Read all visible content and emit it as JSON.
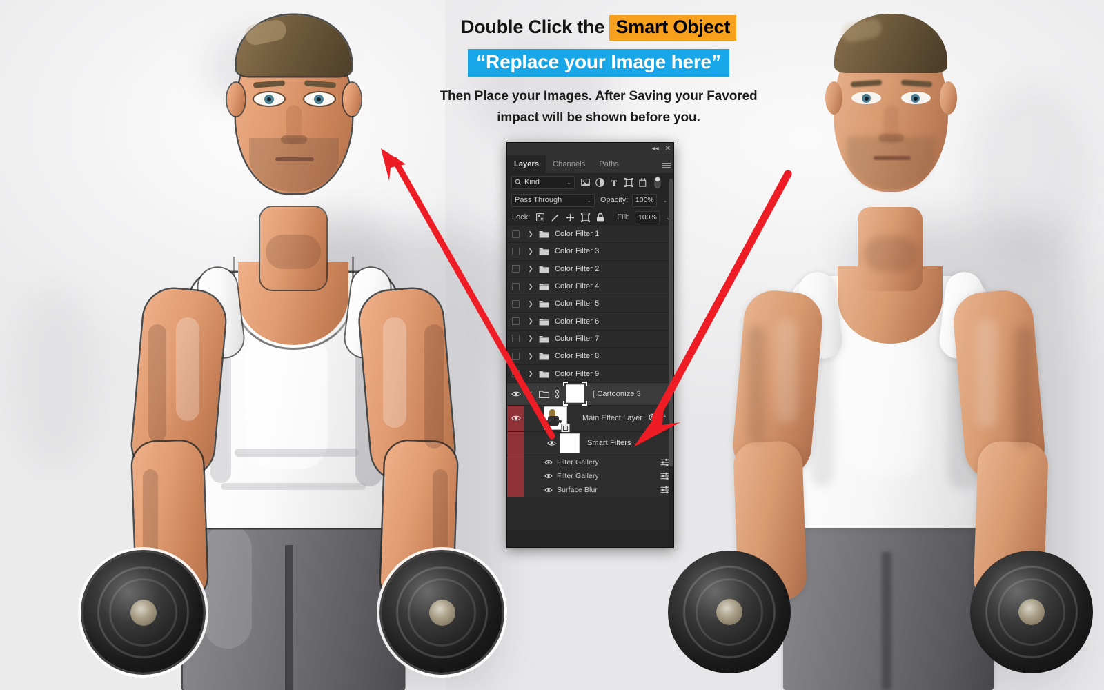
{
  "instructions": {
    "line1_prefix": "Double Click the ",
    "line1_highlight": "Smart Object",
    "line2_highlight": "“Replace your Image here”",
    "line3_a": "Then Place your Images. After Saving your Favored",
    "line3_b": "impact will be shown before you.",
    "highlight_orange": "#F6A01E",
    "highlight_blue": "#17A7E8"
  },
  "panel": {
    "titlebar": {
      "collapse_icon": "◂◂",
      "close_icon": "✕"
    },
    "tabs": [
      {
        "label": "Layers",
        "active": true
      },
      {
        "label": "Channels",
        "active": false
      },
      {
        "label": "Paths",
        "active": false
      }
    ],
    "menu_icon": "hamburger-icon",
    "filter": {
      "search_icon": "search-icon",
      "kind_label": "Kind",
      "chevron": "⌄",
      "icons": [
        "pixel-layer-icon",
        "adjustment-layer-icon",
        "type-layer-icon",
        "shape-layer-icon",
        "smart-object-icon",
        "filter-toggle-icon"
      ]
    },
    "blend": {
      "mode": "Pass Through",
      "chevron": "⌄",
      "opacity_label": "Opacity:",
      "opacity_value": "100%"
    },
    "lock": {
      "label": "Lock:",
      "icons": [
        "transparency-lock-icon",
        "brush-lock-icon",
        "move-lock-icon",
        "artboard-lock-icon",
        "all-lock-icon"
      ],
      "fill_label": "Fill:",
      "fill_value": "100%"
    },
    "layers": [
      {
        "name": "Color Filter 1",
        "type": "group",
        "visible": false,
        "selected": false
      },
      {
        "name": "Color Filter 3",
        "type": "group",
        "visible": false,
        "selected": false
      },
      {
        "name": "Color Filter 2",
        "type": "group",
        "visible": false,
        "selected": false
      },
      {
        "name": "Color Filter 4",
        "type": "group",
        "visible": false,
        "selected": false
      },
      {
        "name": "Color Filter 5",
        "type": "group",
        "visible": false,
        "selected": false
      },
      {
        "name": "Color Filter 6",
        "type": "group",
        "visible": false,
        "selected": false
      },
      {
        "name": "Color Filter 7",
        "type": "group",
        "visible": false,
        "selected": false
      },
      {
        "name": "Color Filter 8",
        "type": "group",
        "visible": false,
        "selected": false
      },
      {
        "name": "Color Filter 9",
        "type": "group",
        "visible": false,
        "selected": false
      }
    ],
    "cartoonize_layer": {
      "name": "[ Cartoonize 3",
      "visible": true,
      "eye_icon": "eye-icon",
      "check_icon": "check-icon",
      "folder_icon": "folder-icon",
      "link_icon": "link-icon"
    },
    "main_effect_layer": {
      "name": "Main Effect Layer",
      "visible": true,
      "eye_icon": "eye-icon",
      "fx_icon": "effects-icon",
      "collapse_icon": "⌃",
      "selected": true,
      "selection_color": "#8F3338"
    },
    "smart_filters": {
      "name": "Smart Filters",
      "visible": true,
      "eye_icon": "eye-icon",
      "items": [
        {
          "name": "Filter Gallery",
          "visible": true,
          "slider_icon": "sliders-icon"
        },
        {
          "name": "Filter Gallery",
          "visible": true,
          "slider_icon": "sliders-icon"
        },
        {
          "name": "Surface Blur",
          "visible": true,
          "slider_icon": "sliders-icon"
        }
      ]
    },
    "scrollbar": "vertical-scrollbar"
  },
  "annotations": {
    "arrow_1": "arrow-to-cartoon-preview",
    "arrow_2": "arrow-to-main-effect-layer",
    "arrow_color": "#EE1C25"
  },
  "images": {
    "left": {
      "name": "cartoon-effect-preview",
      "subject": "muscular man in white tank top holding dumbbells"
    },
    "right": {
      "name": "original-photo",
      "subject": "muscular man in white tank top holding dumbbells"
    }
  }
}
